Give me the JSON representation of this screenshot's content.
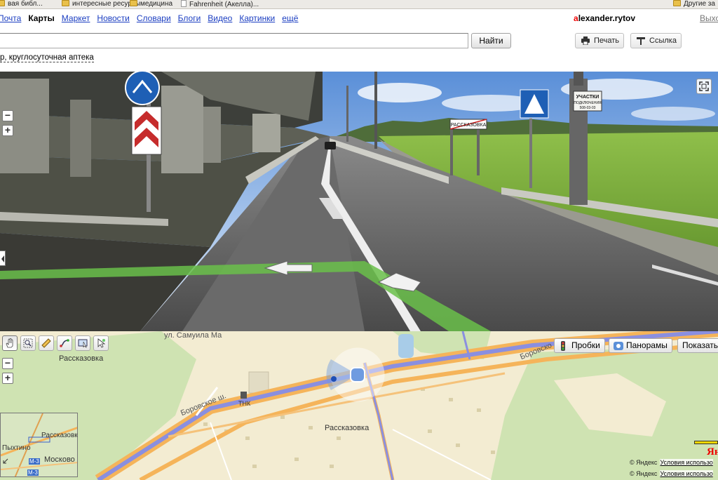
{
  "bookmarks": [
    {
      "label": "вая библ...",
      "icon": "folder-icon"
    },
    {
      "label": "интересные ресурсы",
      "icon": "folder-icon"
    },
    {
      "label": "медицина",
      "icon": "folder-icon"
    },
    {
      "label": "Fahrenheit (Акелла)...",
      "icon": "page-icon"
    },
    {
      "label": "Другие за",
      "icon": "folder-icon"
    }
  ],
  "nav": {
    "items": [
      "Почта",
      "Карты",
      "Маркет",
      "Новости",
      "Словари",
      "Блоги",
      "Видео",
      "Картинки",
      "ещё"
    ],
    "active": "Карты"
  },
  "user": {
    "first_letter": "a",
    "rest": "lexander.rytov"
  },
  "exit_label": "Выхо",
  "search": {
    "value": "",
    "button": "Найти"
  },
  "toolbar": {
    "print": "Печать",
    "link": "Ссылка"
  },
  "search_hint": "р, круглосуточная аптека",
  "panorama": {
    "sign_town": "РАССКАЗОВКА",
    "sign_plot_1": "УЧАСТКИ",
    "sign_plot_2": "ПОДКЛЮЧЕНИЯ",
    "sign_plot_3": "508-03-03",
    "zoom_minus": "−",
    "zoom_plus": "+"
  },
  "map": {
    "layers": {
      "traffic": "Пробки",
      "panoramas": "Панорамы",
      "show": "Показать"
    },
    "zoom_minus": "−",
    "zoom_plus": "+",
    "labels": {
      "village_top": "Рассказовка",
      "village_center": "Рассказовка",
      "road_borovskoe": "Боровское ш.",
      "road_borovskoe_right": "Боровско",
      "street_top": "ул. Самуила Ма",
      "gas_station": "ТНК"
    },
    "minimap": {
      "labels": [
        "Рассказовка",
        "Пыхтино",
        "Москово",
        "М-3",
        "М-3"
      ]
    },
    "copyright": "© Яндекс",
    "terms": "Условия использо",
    "copyright2": "© Яндекс",
    "terms2": "Условия использо",
    "logo": "Ян"
  },
  "colors": {
    "link": "#1a3dc1",
    "accent": "#e00000",
    "road_orange": "#f5b45a",
    "road_blue": "#8a8fe0"
  }
}
